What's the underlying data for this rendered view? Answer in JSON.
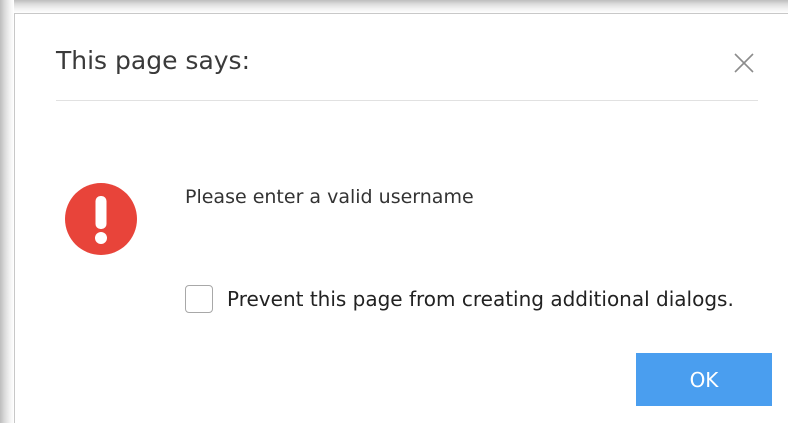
{
  "dialog": {
    "title": "This page says:",
    "close_icon": "close-icon",
    "alert_icon": "error-exclamation-icon",
    "message": "Please enter a valid username",
    "checkbox": {
      "label": "Prevent this page from creating additional dialogs.",
      "checked": false
    },
    "ok_label": "OK"
  },
  "colors": {
    "accent": "#4a9eef",
    "error": "#e8443a",
    "title_text": "#3a3a3a",
    "body_text": "#333333"
  }
}
